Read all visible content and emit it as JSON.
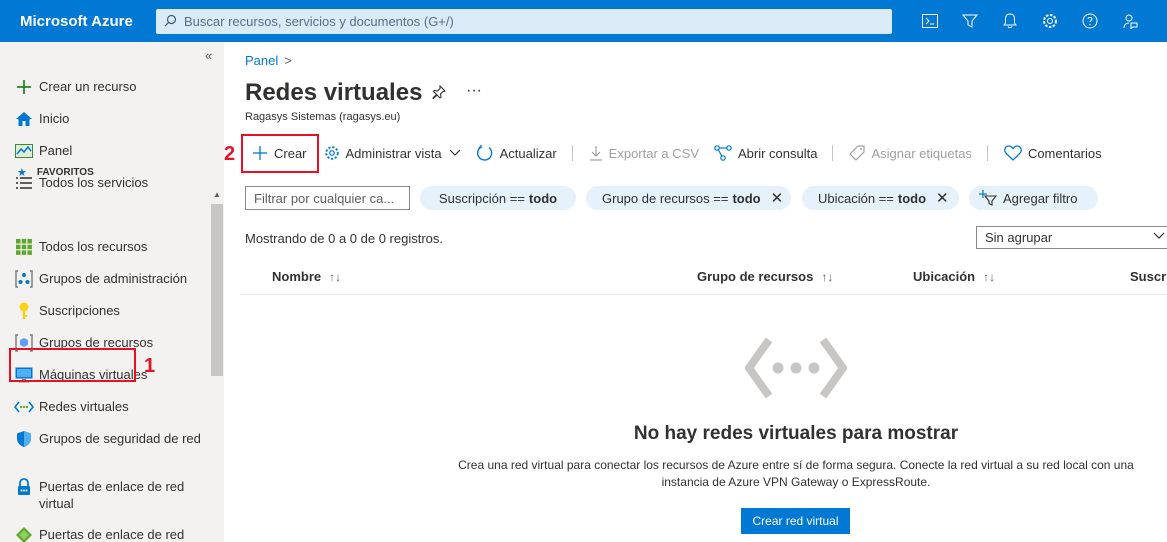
{
  "topbar": {
    "brand": "Microsoft Azure",
    "search_placeholder": "Buscar recursos, servicios y documentos (G+/)",
    "icons": [
      "cloud-shell-icon",
      "directory-filter-icon",
      "notifications-icon",
      "settings-icon",
      "help-icon",
      "feedback-icon"
    ]
  },
  "sidebar": {
    "collapse": "«",
    "favorites_header": "FAVORITOS",
    "items": [
      {
        "label": "Crear un recurso"
      },
      {
        "label": "Inicio"
      },
      {
        "label": "Panel"
      },
      {
        "label": "Todos los servicios"
      },
      {
        "label": "Todos los recursos"
      },
      {
        "label": "Grupos de administración"
      },
      {
        "label": "Suscripciones"
      },
      {
        "label": "Grupos de recursos"
      },
      {
        "label": "Máquinas virtuales"
      },
      {
        "label": "Redes virtuales"
      },
      {
        "label": "Grupos de seguridad de red"
      },
      {
        "label": "Puertas de enlace de red virtual"
      },
      {
        "label": "Puertas de enlace de red"
      }
    ]
  },
  "annotations": {
    "step1": "1",
    "step2": "2"
  },
  "main": {
    "breadcrumb": "Panel",
    "breadcrumb_sep": ">",
    "title": "Redes virtuales",
    "more": "···",
    "subtitle": "Ragasys Sistemas (ragasys.eu)",
    "toolbar": {
      "create": "Crear",
      "manage_view": "Administrar vista",
      "refresh": "Actualizar",
      "export_csv": "Exportar a CSV",
      "open_query": "Abrir consulta",
      "assign_tags": "Asignar etiquetas",
      "feedback": "Comentarios"
    },
    "filter_placeholder": "Filtrar por cualquier ca...",
    "pills": [
      {
        "label": "Suscripción ==",
        "value": "todo"
      },
      {
        "label": "Grupo de recursos ==",
        "value": "todo"
      },
      {
        "label": "Ubicación ==",
        "value": "todo"
      }
    ],
    "add_filter": "Agregar filtro",
    "showing": "Mostrando de 0 a 0 de 0 registros.",
    "group_by": "Sin agrupar",
    "columns": [
      "Nombre",
      "Grupo de recursos",
      "Ubicación",
      "Suscripc"
    ],
    "sort_glyph": "↑↓",
    "empty_title": "No hay redes virtuales para mostrar",
    "empty_desc": "Crea una red virtual para conectar los recursos de Azure entre sí de forma segura. Conecte la red virtual a su red local con una instancia de Azure VPN Gateway o ExpressRoute.",
    "create_button": "Crear red virtual"
  }
}
